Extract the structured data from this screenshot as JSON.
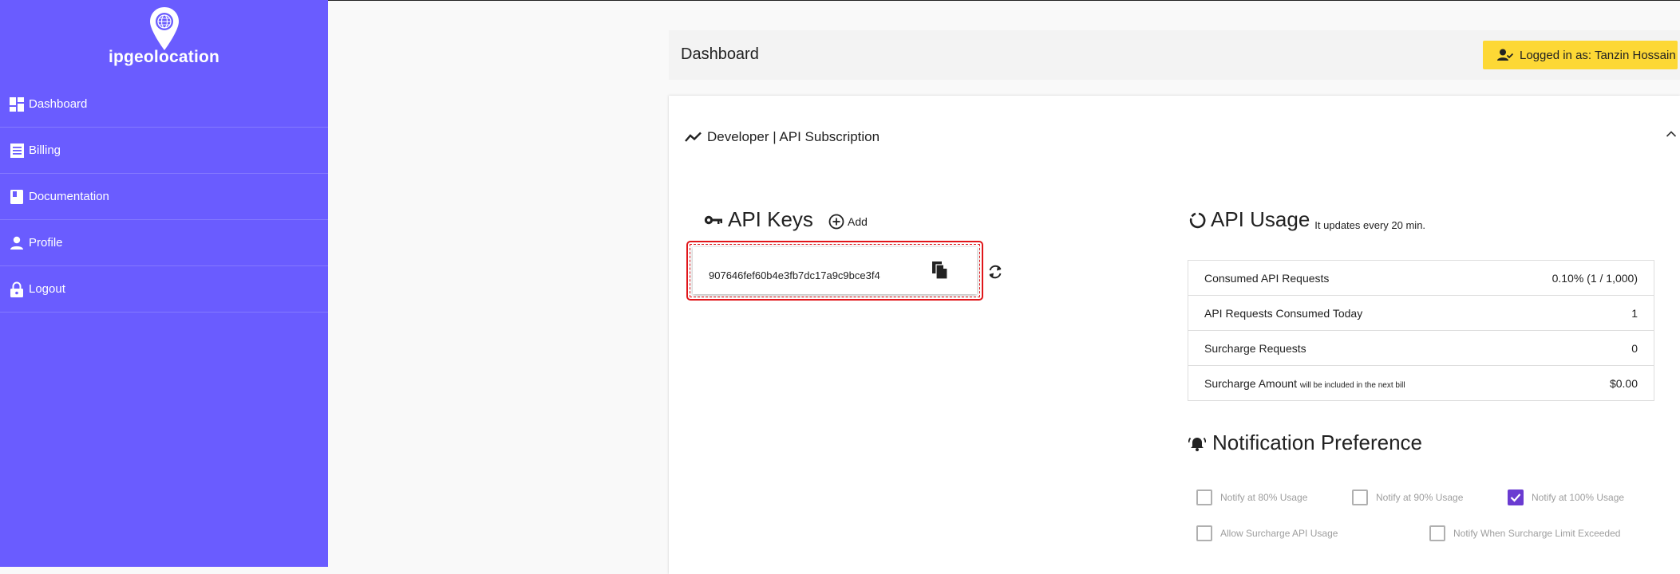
{
  "app": {
    "brand": "ipgeolocation",
    "accent_color": "#6a5cff",
    "badge_color": "#fdd835",
    "key_highlight_color": "#e0161a",
    "checkbox_checked_color": "#6a3bd1"
  },
  "sidebar": {
    "items": [
      {
        "label": "Dashboard",
        "icon": "dashboard-icon"
      },
      {
        "label": "Billing",
        "icon": "billing-icon"
      },
      {
        "label": "Documentation",
        "icon": "book-icon"
      },
      {
        "label": "Profile",
        "icon": "person-icon"
      },
      {
        "label": "Logout",
        "icon": "lock-icon"
      }
    ]
  },
  "header": {
    "title": "Dashboard",
    "logged_in": "Logged in as: Tanzin Hossain"
  },
  "panel": {
    "title": "Developer | API Subscription"
  },
  "api_keys": {
    "title": "API Keys",
    "add_label": "Add",
    "key": "907646fef60b4e3fb7dc17a9c9bce3f4"
  },
  "api_usage": {
    "title": "API Usage",
    "subtitle": "It updates every 20 min.",
    "rows": [
      {
        "label": "Consumed API Requests",
        "note": "",
        "value": "0.10% (1 / 1,000)"
      },
      {
        "label": "API Requests Consumed Today",
        "note": "",
        "value": "1"
      },
      {
        "label": "Surcharge Requests",
        "note": "",
        "value": "0"
      },
      {
        "label": "Surcharge Amount",
        "note": "will be included in the next bill",
        "value": "$0.00"
      }
    ]
  },
  "notifications": {
    "title": "Notification Preference",
    "options": [
      {
        "label": "Notify at 80% Usage",
        "checked": false
      },
      {
        "label": "Notify at 90% Usage",
        "checked": false
      },
      {
        "label": "Notify at 100% Usage",
        "checked": true
      },
      {
        "label": "Allow Surcharge API Usage",
        "checked": false
      },
      {
        "label": "Notify When Surcharge Limit Exceeded",
        "checked": false
      }
    ]
  }
}
